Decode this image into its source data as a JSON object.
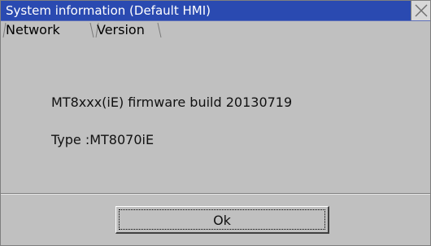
{
  "window": {
    "title": "System information (Default HMI)",
    "close_icon": "close-icon"
  },
  "tabs": [
    {
      "label": "Network",
      "active": false
    },
    {
      "label": "Version",
      "active": true
    }
  ],
  "content": {
    "firmware_line": "MT8xxx(iE) firmware build 20130719",
    "type_line": "Type :MT8070iE"
  },
  "footer": {
    "ok_label": "Ok"
  }
}
